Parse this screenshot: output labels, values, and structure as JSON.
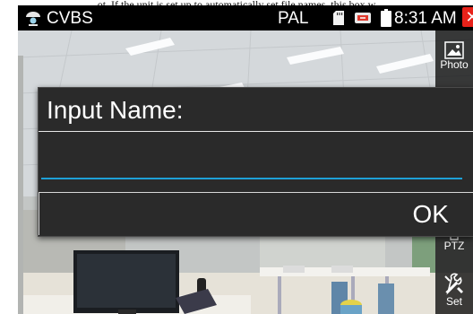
{
  "caption": "ot. If the unit is set up to automatically set file names, this box w",
  "statusbar": {
    "title": "CVBS",
    "signal": "PAL",
    "time": "8:31 AM",
    "close_label": "✕",
    "close_color": "#e8221a",
    "icons": [
      "camera-app-icon",
      "sd-card-icon",
      "sync-icon",
      "battery-icon",
      "close-icon"
    ]
  },
  "toolbar": {
    "items": [
      {
        "label": "Photo",
        "icon": "photo-icon"
      },
      {
        "label": "PTZ",
        "icon": "ptz-icon"
      },
      {
        "label": "Set",
        "icon": "tools-icon"
      }
    ]
  },
  "dialog": {
    "title": "Input Name:",
    "input_value": "",
    "ok_label": "OK",
    "accent_color": "#1ea0d7"
  }
}
